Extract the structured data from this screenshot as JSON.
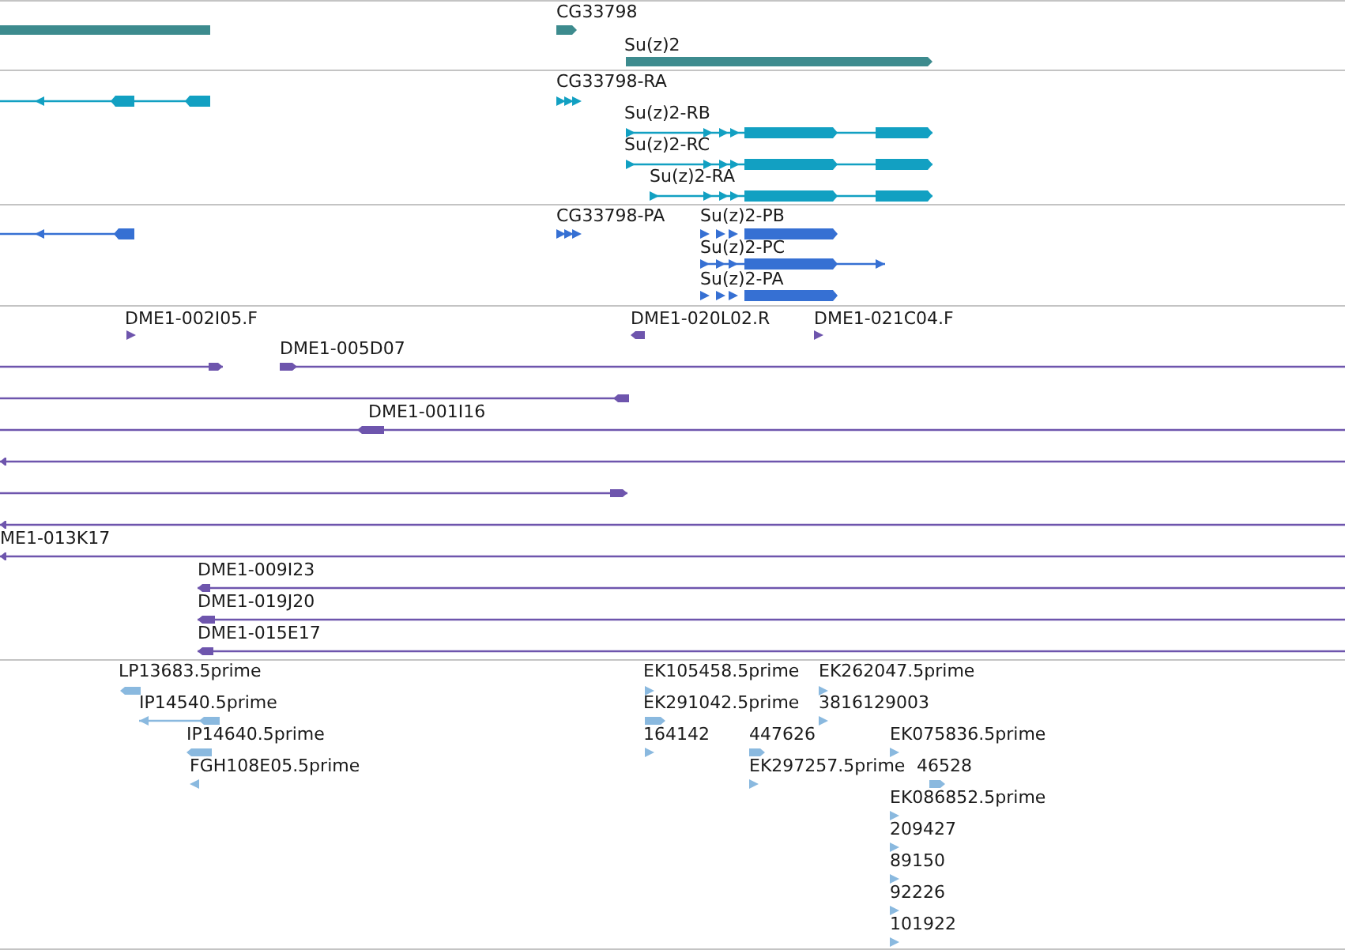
{
  "tracks": [
    {
      "kind": "gene",
      "color": "#3d8b8e",
      "features": [
        {
          "reverse": true
        },
        {
          "label": "CG33798",
          "reverse": false
        },
        {
          "label": "Su(z)2",
          "reverse": false
        }
      ]
    },
    {
      "kind": "transcript",
      "color": "#12a0c2",
      "features": [
        {
          "reverse": true
        },
        {
          "label": "CG33798-RA",
          "reverse": false
        },
        {
          "label": "Su(z)2-RB",
          "reverse": false
        },
        {
          "label": "Su(z)2-RC",
          "reverse": false
        },
        {
          "label": "Su(z)2-RA",
          "reverse": false
        }
      ]
    },
    {
      "kind": "transcript",
      "color": "#3670d3",
      "features": [
        {
          "reverse": true
        },
        {
          "label": "CG33798-PA",
          "reverse": false
        },
        {
          "label": "Su(z)2-PB",
          "reverse": false
        },
        {
          "label": "Su(z)2-PC",
          "reverse": false
        },
        {
          "label": "Su(z)2-PA",
          "reverse": false
        }
      ]
    },
    {
      "kind": "match",
      "color": "#6e55ad",
      "features": [
        {
          "label": "DME1-002I05.F",
          "reverse": false
        },
        {
          "label": "DME1-020L02.R",
          "reverse": true
        },
        {
          "label": "DME1-021C04.F",
          "reverse": false
        },
        {
          "reverse": false
        },
        {
          "label": "DME1-005D07",
          "reverse": false
        },
        {
          "reverse": true
        },
        {
          "label": "DME1-001I16",
          "reverse": true
        },
        {
          "reverse": true
        },
        {
          "reverse": false
        },
        {
          "reverse": true
        },
        {
          "label": "ME1-013K17",
          "reverse": true
        },
        {
          "label": "DME1-009I23",
          "reverse": true
        },
        {
          "label": "DME1-019J20",
          "reverse": true
        },
        {
          "label": "DME1-015E17",
          "reverse": true
        }
      ]
    },
    {
      "kind": "match",
      "color": "#8ab9df",
      "features": [
        {
          "label": "LP13683.5prime",
          "reverse": true
        },
        {
          "label": "IP14540.5prime",
          "reverse": true
        },
        {
          "label": "IP14640.5prime",
          "reverse": true
        },
        {
          "label": "FGH108E05.5prime",
          "reverse": true
        },
        {
          "label": "EK105458.5prime",
          "reverse": false
        },
        {
          "label": "EK262047.5prime",
          "reverse": false
        },
        {
          "label": "EK291042.5prime",
          "reverse": false
        },
        {
          "label": "3816129003",
          "reverse": false
        },
        {
          "label": "164142",
          "reverse": false
        },
        {
          "label": "447626",
          "reverse": false
        },
        {
          "label": "EK075836.5prime",
          "reverse": false
        },
        {
          "label": "EK297257.5prime",
          "reverse": false
        },
        {
          "label": "46528",
          "reverse": false
        },
        {
          "label": "EK086852.5prime",
          "reverse": false
        },
        {
          "label": "209427",
          "reverse": false
        },
        {
          "label": "89150",
          "reverse": false
        },
        {
          "label": "92226",
          "reverse": false
        },
        {
          "label": "101922",
          "reverse": false
        }
      ]
    }
  ]
}
